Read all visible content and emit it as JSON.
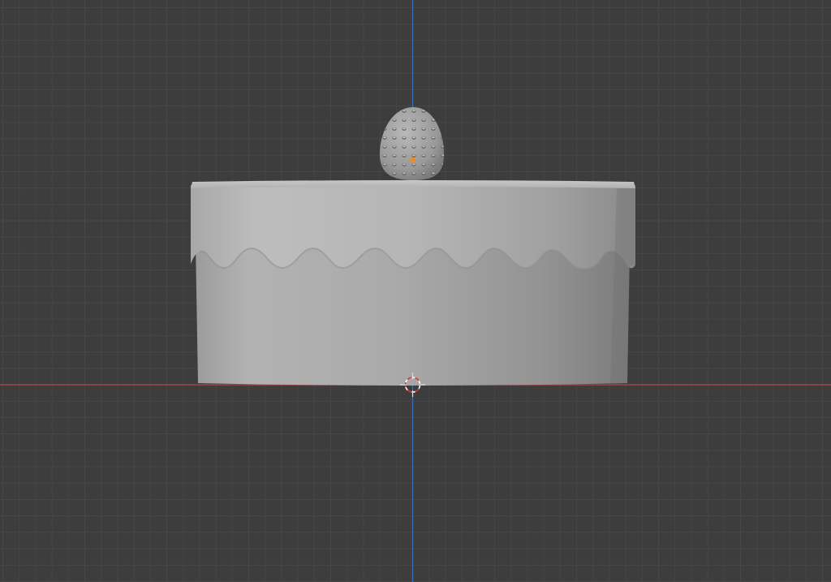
{
  "viewport": {
    "background_color": "#3d3d3d",
    "grid_minor_color": "#474747",
    "grid_major_color": "#505050",
    "x_axis_color": "#b5454b",
    "z_axis_color": "#3f6fb5"
  },
  "scene": {
    "objects": [
      {
        "name": "cake",
        "shape": "cylinder",
        "color": "#a3a3a3"
      },
      {
        "name": "strawberry",
        "shape": "egg",
        "color": "#9a9a9a"
      }
    ],
    "selected_origin_color": "#f28c1a",
    "cursor_icon": "3d-cursor-icon"
  }
}
